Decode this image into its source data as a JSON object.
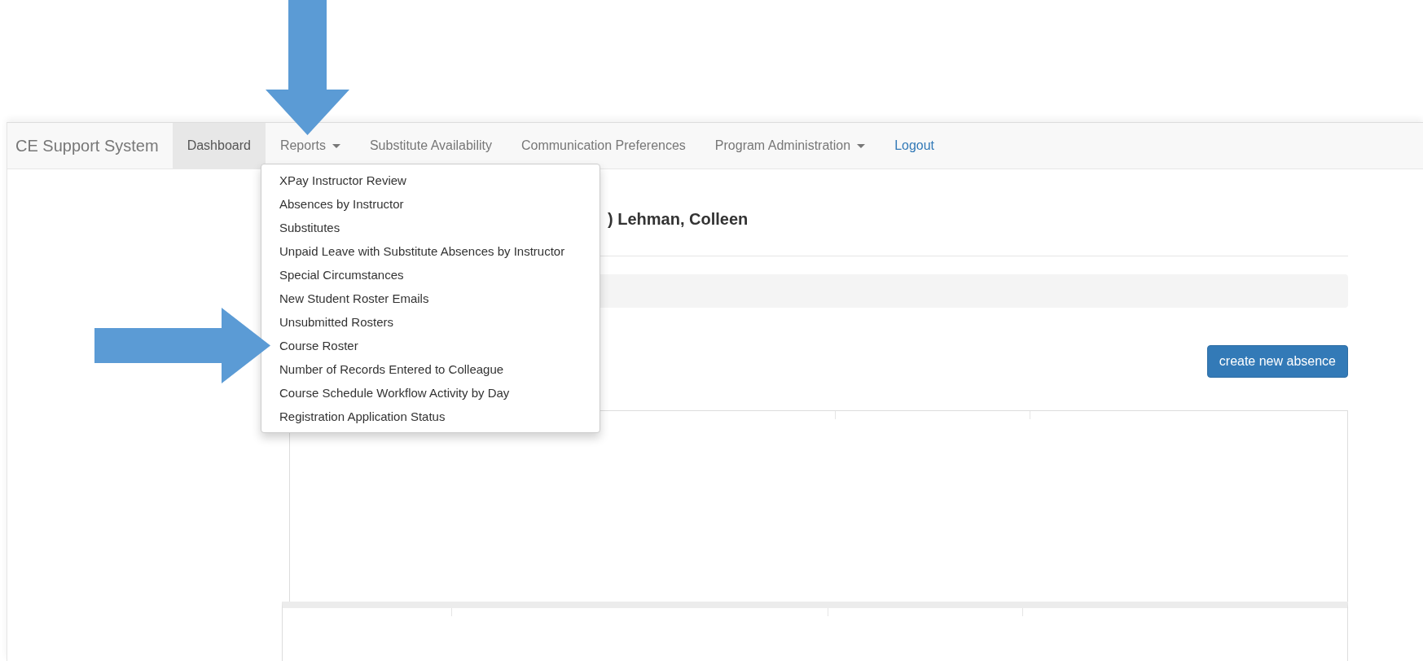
{
  "navbar": {
    "brand": "CE Support System",
    "items": [
      {
        "label": "Dashboard",
        "kind": "tab",
        "selected": true,
        "caret": false
      },
      {
        "label": "Reports",
        "kind": "tab",
        "selected": false,
        "caret": true
      },
      {
        "label": "Substitute Availability",
        "kind": "tab",
        "selected": false,
        "caret": false
      },
      {
        "label": "Communication Preferences",
        "kind": "tab",
        "selected": false,
        "caret": false
      },
      {
        "label": "Program Administration",
        "kind": "tab",
        "selected": false,
        "caret": true
      },
      {
        "label": "Logout",
        "kind": "link",
        "selected": false,
        "caret": false
      }
    ]
  },
  "dropdown": {
    "items": [
      "XPay Instructor Review",
      "Absences by Instructor",
      "Substitutes",
      "Unpaid Leave with Substitute Absences by Instructor",
      "Special Circumstances",
      "New Student Roster Emails",
      "Unsubmitted Rosters",
      "Course Roster",
      "Number of Records Entered to Colleague",
      "Course Schedule Workflow Activity by Day",
      "Registration Application Status"
    ]
  },
  "heading": ") Lehman, Colleen",
  "button": "create new absence"
}
